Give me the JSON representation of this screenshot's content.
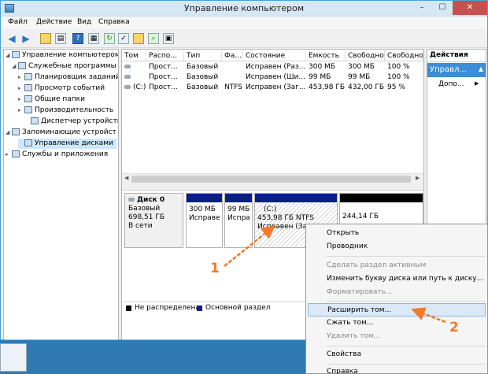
{
  "window": {
    "title": "Управление компьютером"
  },
  "menu": [
    "Файл",
    "Действие",
    "Вид",
    "Справка"
  ],
  "tree": {
    "root": "Управление компьютером (л",
    "service": "Служебные программы",
    "scheduler": "Планировщик заданий",
    "events": "Просмотр событий",
    "shared": "Общие папки",
    "performance": "Производительность",
    "devices": "Диспетчер устройств",
    "storage": "Запоминающие устройст",
    "disks": "Управление дисками",
    "services": "Службы и приложения"
  },
  "volumes": {
    "headers": [
      "Том",
      "Распо...",
      "Тип",
      "Фа...",
      "Состояние",
      "Емкость",
      "Свободно",
      "Свободно"
    ],
    "rows": [
      [
        "",
        "Прост...",
        "Базовый",
        "",
        "Исправен (Раз...",
        "300 МБ",
        "300 МБ",
        "100 %"
      ],
      [
        "",
        "Прост...",
        "Базовый",
        "",
        "Исправен (Ши...",
        "99 МБ",
        "99 МБ",
        "100 %"
      ],
      [
        "(C:)",
        "Прост...",
        "Базовый",
        "NTFS",
        "Исправен (Заг...",
        "453,98 ГБ",
        "432,00 ГБ",
        "95 %"
      ]
    ]
  },
  "disk": {
    "name": "Диск 0",
    "type": "Базовый",
    "size": "698,51 ГБ",
    "status": "В сети",
    "p1": {
      "size": "300 МБ",
      "status": "Исправе"
    },
    "p2": {
      "size": "99 МБ",
      "status": "Испра"
    },
    "p3": {
      "label": "(C:)",
      "size": "453,98 ГБ NTFS",
      "status": "Исправен (Заг"
    },
    "p4": {
      "size": "244,14 ГБ"
    }
  },
  "legend": {
    "unallocated": "Не распределена",
    "primary": "Основной раздел"
  },
  "actions": {
    "header": "Действия",
    "section": "Управл...",
    "more": "Допо..."
  },
  "context_menu": {
    "open": "Открыть",
    "explorer": "Проводник",
    "make_active": "Сделать раздел активным",
    "change_letter": "Изменить букву диска или путь к диску...",
    "format": "Форматировать...",
    "extend": "Расширить том...",
    "shrink": "Сжать том...",
    "delete": "Удалить том...",
    "properties": "Свойства",
    "help": "Справка"
  },
  "annotations": {
    "first": "1",
    "second": "2"
  },
  "colors": {
    "accent": "#3b8ed6",
    "primary_partition": "#0a1e8a",
    "annotation": "#f07a2a"
  }
}
